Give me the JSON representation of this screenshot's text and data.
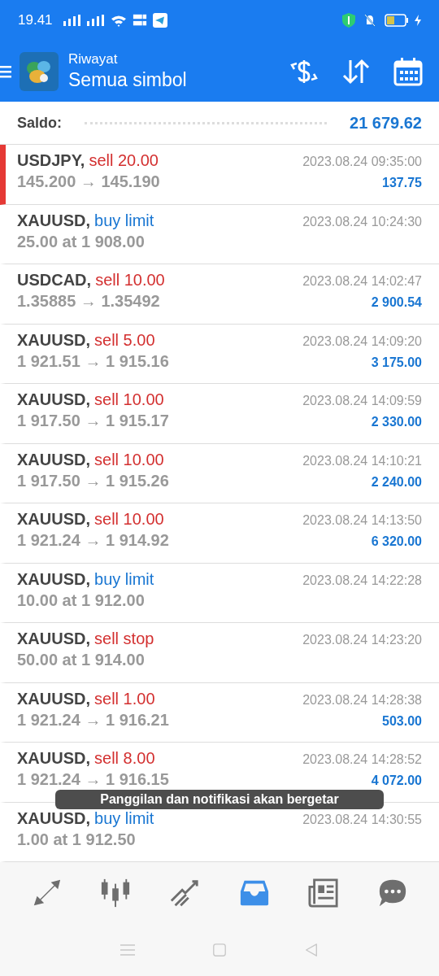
{
  "status_bar": {
    "time": "19.41"
  },
  "header": {
    "subtitle": "Riwayat",
    "title": "Semua simbol"
  },
  "balance": {
    "label": "Saldo:",
    "value": "21 679.62"
  },
  "deals": [
    {
      "symbol": "USDJPY,",
      "order": "sell 20.00",
      "kind": "sell",
      "prices": "145.200 → 145.190",
      "time": "2023.08.24 09:35:00",
      "profit": "137.75",
      "selected": true
    },
    {
      "symbol": "XAUUSD,",
      "order": "buy limit",
      "kind": "buy",
      "prices": "25.00 at 1 908.00",
      "time": "2023.08.24 10:24:30",
      "selected": false
    },
    {
      "symbol": "USDCAD,",
      "order": "sell 10.00",
      "kind": "sell",
      "prices": "1.35885 → 1.35492",
      "time": "2023.08.24 14:02:47",
      "profit": "2 900.54",
      "selected": false
    },
    {
      "symbol": "XAUUSD,",
      "order": "sell 5.00",
      "kind": "sell",
      "prices": "1 921.51 → 1 915.16",
      "time": "2023.08.24 14:09:20",
      "profit": "3 175.00",
      "selected": false
    },
    {
      "symbol": "XAUUSD,",
      "order": "sell 10.00",
      "kind": "sell",
      "prices": "1 917.50 → 1 915.17",
      "time": "2023.08.24 14:09:59",
      "profit": "2 330.00",
      "selected": false
    },
    {
      "symbol": "XAUUSD,",
      "order": "sell 10.00",
      "kind": "sell",
      "prices": "1 917.50 → 1 915.26",
      "time": "2023.08.24 14:10:21",
      "profit": "2 240.00",
      "selected": false
    },
    {
      "symbol": "XAUUSD,",
      "order": "sell 10.00",
      "kind": "sell",
      "prices": "1 921.24 → 1 914.92",
      "time": "2023.08.24 14:13:50",
      "profit": "6 320.00",
      "selected": false
    },
    {
      "symbol": "XAUUSD,",
      "order": "buy limit",
      "kind": "buy",
      "prices": "10.00 at 1 912.00",
      "time": "2023.08.24 14:22:28",
      "selected": false
    },
    {
      "symbol": "XAUUSD,",
      "order": "sell stop",
      "kind": "sell",
      "prices": "50.00 at 1 914.00",
      "time": "2023.08.24 14:23:20",
      "selected": false
    },
    {
      "symbol": "XAUUSD,",
      "order": "sell 1.00",
      "kind": "sell",
      "prices": "1 921.24 → 1 916.21",
      "time": "2023.08.24 14:28:38",
      "profit": "503.00",
      "selected": false
    },
    {
      "symbol": "XAUUSD,",
      "order": "sell 8.00",
      "kind": "sell",
      "prices": "1 921.24 → 1 916.15",
      "time": "2023.08.24 14:28:52",
      "profit": "4 072.00",
      "selected": false
    },
    {
      "symbol": "XAUUSD,",
      "order": "buy limit",
      "kind": "buy",
      "prices": "1.00 at 1 912.50",
      "time": "2023.08.24 14:30:55",
      "selected": false
    }
  ],
  "toast": "Panggilan dan notifikasi akan bergetar",
  "bottom_nav": [
    {
      "kind": "quotes",
      "selected": false
    },
    {
      "kind": "chart",
      "selected": false
    },
    {
      "kind": "trade",
      "selected": false
    },
    {
      "kind": "history",
      "selected": true
    },
    {
      "kind": "news",
      "selected": false
    },
    {
      "kind": "chat",
      "selected": false
    }
  ]
}
